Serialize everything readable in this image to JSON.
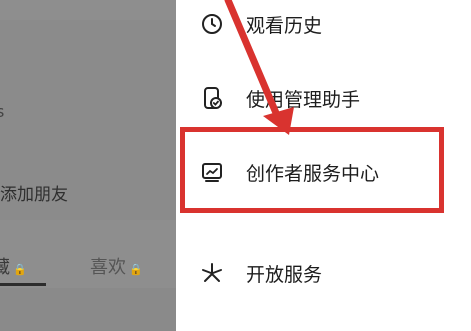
{
  "background_profile": {
    "partial_text": "s",
    "add_friend_label": "添加朋友",
    "tabs": [
      {
        "label": "藏",
        "locked": true
      },
      {
        "label": "喜欢",
        "locked": true
      }
    ]
  },
  "drawer": {
    "items": [
      {
        "label": "观看历史",
        "icon": "clock-icon"
      },
      {
        "label": "使用管理助手",
        "icon": "phone-check-icon"
      },
      {
        "label": "创作者服务中心",
        "icon": "chart-icon",
        "highlighted": true
      },
      {
        "label": "开放服务",
        "icon": "asterisk-icon"
      }
    ]
  },
  "annotation": {
    "color": "#d9332f"
  }
}
